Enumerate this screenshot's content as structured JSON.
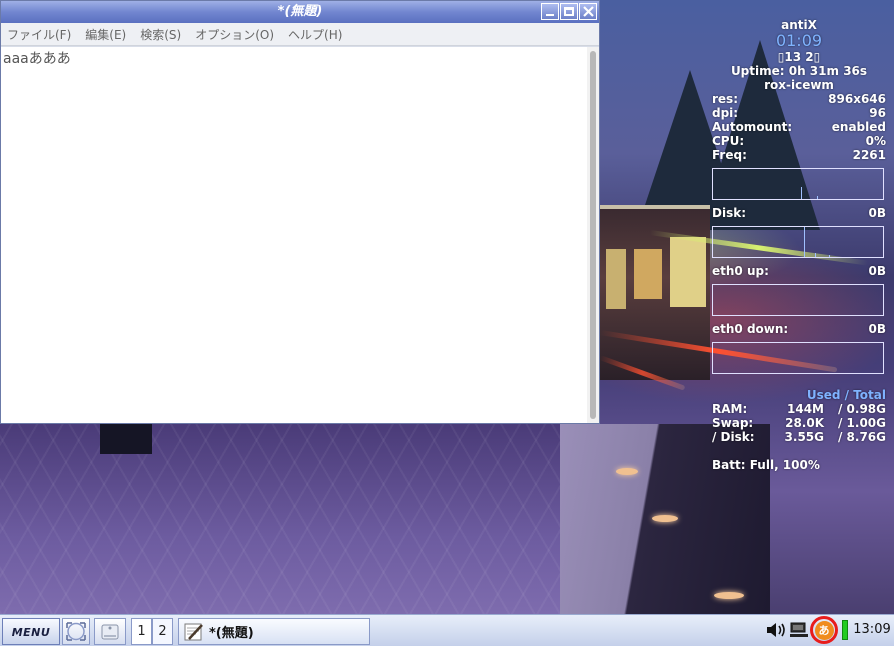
{
  "editor": {
    "title": "*(無題)",
    "menu": [
      "ファイル(F)",
      "編集(E)",
      "検索(S)",
      "オプション(O)",
      "ヘルプ(H)"
    ],
    "content": "aaaあああ"
  },
  "conky": {
    "hostname": "antiX",
    "time": "01:09",
    "date": "▯13 2▯",
    "uptime": "Uptime: 0h 31m 36s",
    "wm": "rox-icewm",
    "res": {
      "label": "res:",
      "value": "896x646"
    },
    "dpi": {
      "label": "dpi:",
      "value": "96"
    },
    "automount": {
      "label": "Automount:",
      "value": "enabled"
    },
    "cpu": {
      "label": "CPU:",
      "value": "0%"
    },
    "freq": {
      "label": "Freq:",
      "value": "2261"
    },
    "disk": {
      "label": "Disk:",
      "value": "0B"
    },
    "eth0_up": {
      "label": "eth0 up:",
      "value": "0B"
    },
    "eth0_down": {
      "label": "eth0 down:",
      "value": "0B"
    },
    "used_total_header": "Used / Total",
    "ram": {
      "label": "RAM:",
      "used": "144M",
      "total": "/ 0.98G"
    },
    "swap": {
      "label": "Swap:",
      "used": "28.0K",
      "total": "/ 1.00G"
    },
    "root_disk": {
      "label": "/ Disk:",
      "used": "3.55G",
      "total": "/ 8.76G"
    },
    "battery": "Batt: Full, 100%"
  },
  "taskbar": {
    "menu_label": "MENU",
    "workspaces": [
      "1",
      "2"
    ],
    "task_title": "*(無題)",
    "ime_glyph": "あ",
    "clock": "13:09"
  },
  "colors": {
    "titlebar": "#7286d0",
    "conky_accent": "#7fb3ff",
    "ime_highlight": "#e81c1c",
    "ime_icon": "#f08c1e",
    "battery": "#22cc22"
  }
}
